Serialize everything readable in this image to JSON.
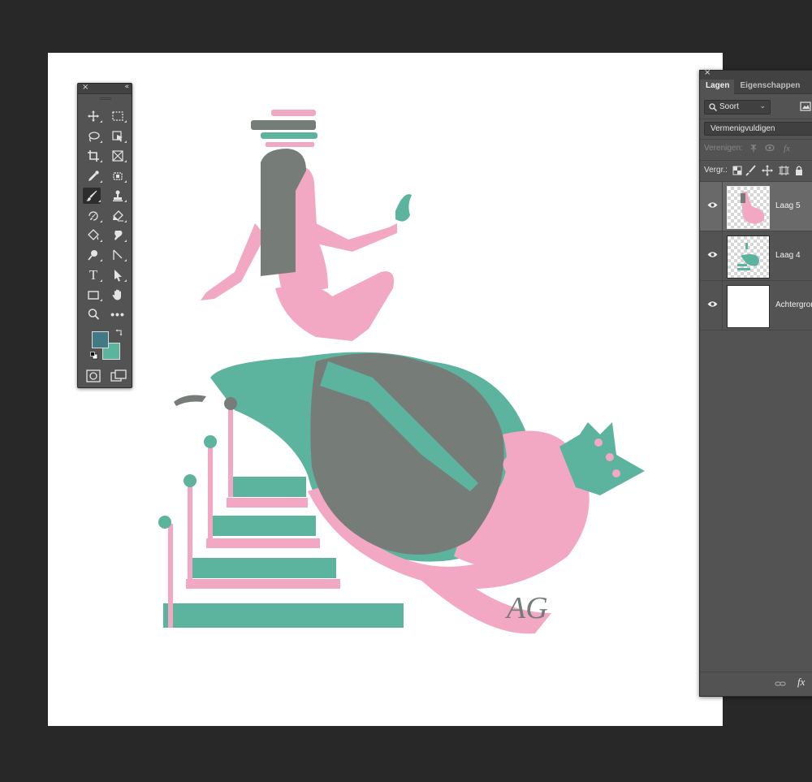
{
  "toolbar": {
    "close_icon": "×",
    "collapse_icon": "«",
    "tools": [
      {
        "name": "move-tool",
        "icon": "move-icon"
      },
      {
        "name": "marquee-tool",
        "icon": "rect-marquee-icon"
      },
      {
        "name": "lasso-tool",
        "icon": "lasso-icon"
      },
      {
        "name": "object-select-tool",
        "icon": "object-select-icon"
      },
      {
        "name": "crop-tool",
        "icon": "crop-icon"
      },
      {
        "name": "frame-tool",
        "icon": "frame-icon"
      },
      {
        "name": "eyedropper-tool",
        "icon": "eyedropper-icon"
      },
      {
        "name": "spot-healing-tool",
        "icon": "bandage-icon"
      },
      {
        "name": "brush-tool",
        "icon": "brush-icon",
        "active": true
      },
      {
        "name": "clone-stamp-tool",
        "icon": "stamp-icon"
      },
      {
        "name": "history-brush-tool",
        "icon": "history-brush-icon"
      },
      {
        "name": "eraser-tool",
        "icon": "eraser-icon"
      },
      {
        "name": "paint-bucket-tool",
        "icon": "bucket-icon"
      },
      {
        "name": "smudge-tool",
        "icon": "smudge-icon"
      },
      {
        "name": "dodge-tool",
        "icon": "dodge-icon"
      },
      {
        "name": "pen-tool",
        "icon": "pen-icon"
      },
      {
        "name": "type-tool",
        "icon": "type-icon",
        "text": "T"
      },
      {
        "name": "path-select-tool",
        "icon": "arrow-icon"
      },
      {
        "name": "rectangle-tool",
        "icon": "rectangle-icon"
      },
      {
        "name": "hand-tool",
        "icon": "hand-icon"
      },
      {
        "name": "zoom-tool",
        "icon": "zoom-icon"
      },
      {
        "name": "more-tools",
        "icon": "more-icon",
        "text": "•••"
      }
    ],
    "foreground_color": "#417a85",
    "background_color": "#5cb39e"
  },
  "layers_panel": {
    "close_icon": "×",
    "tabs": [
      {
        "label": "Lagen",
        "active": true
      },
      {
        "label": "Eigenschappen",
        "active": false
      }
    ],
    "filter": {
      "label": "Soort"
    },
    "blend_mode": "Vermenigvuldigen",
    "unify_label": "Verenigen:",
    "lock_label": "Vergr.:",
    "layers": [
      {
        "name": "Laag 5",
        "visible": true,
        "selected": true
      },
      {
        "name": "Laag 4",
        "visible": true,
        "selected": false
      },
      {
        "name": "Achtergrond",
        "visible": true,
        "selected": false
      }
    ],
    "footer": {
      "fx_label": "fx"
    }
  },
  "canvas": {
    "signature": "AG",
    "colors": {
      "pink": "#f2a8c3",
      "teal": "#5cb39e",
      "overlap": "#767d79"
    }
  }
}
